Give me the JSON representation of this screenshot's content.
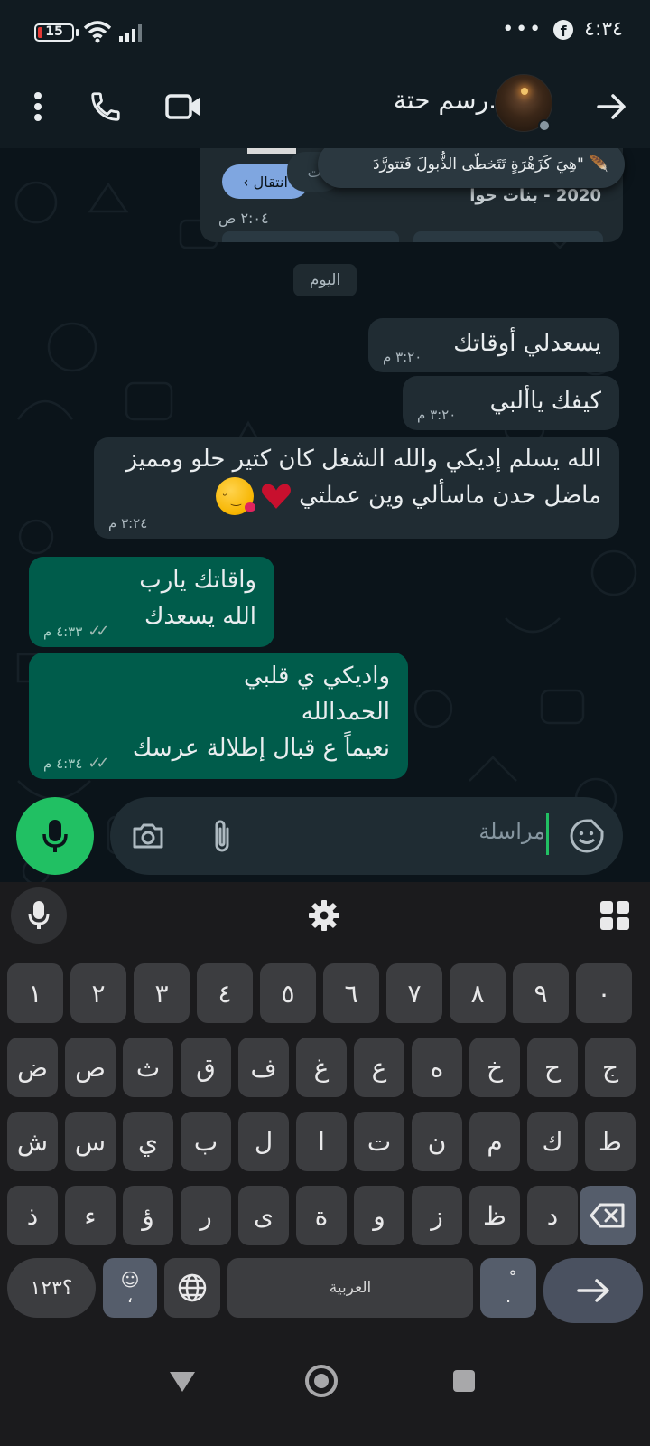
{
  "status_bar": {
    "battery": "15",
    "battery_level_percent": 15,
    "time": "٤:٣٤",
    "overflow_dots": "•••",
    "facebook_icon": "f"
  },
  "header": {
    "contact_name": ".رسم حتة",
    "icons": [
      "more-vert-icon",
      "phone-icon",
      "video-icon",
      "arrow-forward-icon"
    ]
  },
  "chat": {
    "top_card": {
      "tooltip_text": "\"هِيَ كَزَهْرَةٍ تَتَخطّى الذُّبولَ فَتتورَّدَ",
      "quill_icon": "🪶",
      "tooltip_tail_text": "ت",
      "button_label": "انتقال",
      "subtitle": "2020 - بنات حوا",
      "time": "٢:٠٤ ص"
    },
    "day_chip": "اليوم",
    "messages": [
      {
        "dir": "in",
        "lines": [
          "يسعدلي أوقاتك"
        ],
        "time": "٣:٢٠ م"
      },
      {
        "dir": "in",
        "lines": [
          "كيفك ياألبي"
        ],
        "time": "٣:٢٠ م"
      },
      {
        "dir": "in",
        "lines": [
          "الله يسلم إديكي والله الشغل كان كتير حلو ومميز",
          "ماضل حدن ماسألي وين عملتي"
        ],
        "time": "٣:٢٤ م"
      },
      {
        "dir": "out",
        "lines": [
          "واقاتك يارب",
          "الله يسعدك"
        ],
        "time": "٤:٣٣ م"
      },
      {
        "dir": "out",
        "lines": [
          "واديكي ي قلبي",
          "الحمدالله",
          "نعيماً ع قبال إطلالة عرسك"
        ],
        "time": "٤:٣٤ م"
      }
    ]
  },
  "composer": {
    "placeholder": "مراسلة"
  },
  "keyboard": {
    "row_numbers": [
      "١",
      "٢",
      "٣",
      "٤",
      "٥",
      "٦",
      "٧",
      "٨",
      "٩",
      "٠"
    ],
    "row1": [
      "ض",
      "ص",
      "ث",
      "ق",
      "ف",
      "غ",
      "ع",
      "ه",
      "خ",
      "ح",
      "ج"
    ],
    "row2": [
      "ش",
      "س",
      "ي",
      "ب",
      "ل",
      "ا",
      "ت",
      "ن",
      "م",
      "ك",
      "ط"
    ],
    "row3": [
      "ذ",
      "ء",
      "ؤ",
      "ر",
      "ى",
      "ة",
      "و",
      "ز",
      "ظ",
      "د"
    ],
    "symbols_key": "؟١٢٣",
    "emoji_key_top": "☺",
    "emoji_key_bottom": "،",
    "space_label": "العربية",
    "dot_key_top": "ْ",
    "dot_key_bottom": "."
  },
  "colors": {
    "incoming_bubble": "#202c33",
    "outgoing_bubble": "#005c4b",
    "accent_green": "#21c063",
    "background": "#0b141a"
  }
}
